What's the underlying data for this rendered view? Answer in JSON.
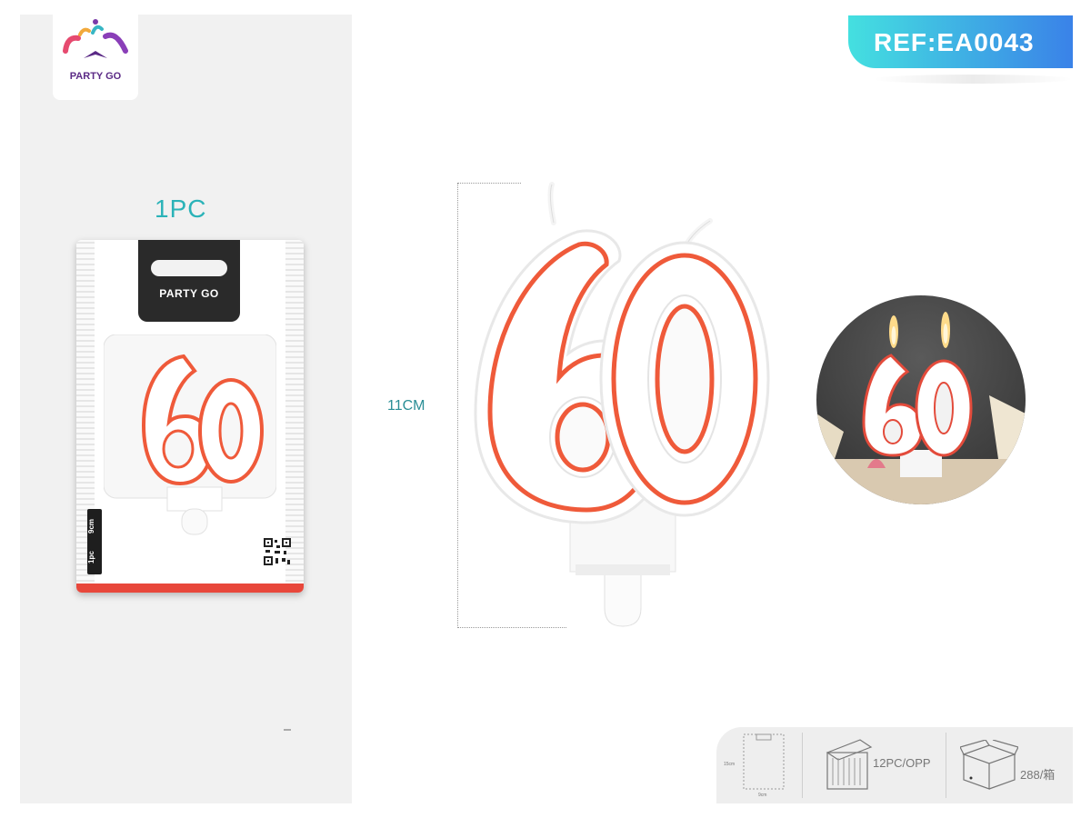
{
  "brand": {
    "logo_text": "PARTY GO"
  },
  "ref": {
    "label": "REF:EA0043"
  },
  "quantity_label": "1PC",
  "dimension": {
    "height_label": "11CM"
  },
  "blister": {
    "brand": "PARTY GO",
    "side_size": "9cm",
    "side_qty": "1pc"
  },
  "packaging": {
    "height": "15cm",
    "width": "9cm",
    "inner_pack": "12PC/OPP",
    "box_qty": "288/箱"
  },
  "colors": {
    "accent_teal": "#2bb3b8",
    "ref_gradient_start": "#44e0e0",
    "ref_gradient_end": "#3a82e8",
    "candle_outline": "#e8473b",
    "brand_purple": "#5b2a86"
  },
  "icons": [
    "party-go-logo-icon",
    "qr-code-icon",
    "display-box-icon",
    "shipping-box-icon"
  ]
}
